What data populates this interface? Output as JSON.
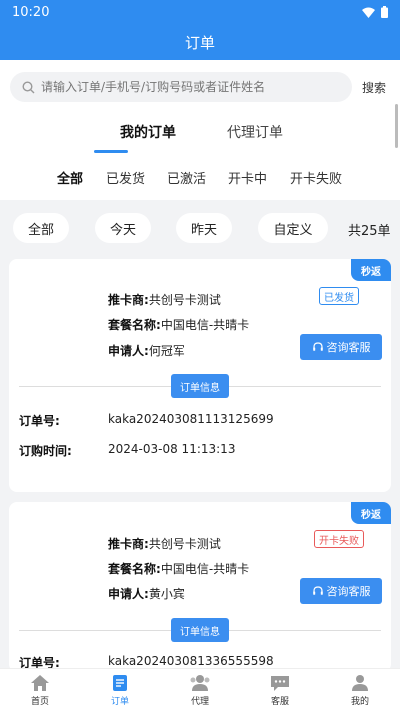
{
  "status_bar": {
    "time": "10:20"
  },
  "app_bar": {
    "title": "订单"
  },
  "search": {
    "placeholder": "请输入订单/手机号/订购号码或者证件姓名",
    "button": "搜索"
  },
  "tabs": [
    {
      "label": "我的订单",
      "active": true
    },
    {
      "label": "代理订单",
      "active": false
    }
  ],
  "status_tabs": [
    "全部",
    "已发货",
    "已激活",
    "开卡中",
    "开卡失败"
  ],
  "filters": [
    "全部",
    "今天",
    "昨天",
    "自定义"
  ],
  "count_label": "共25单",
  "labels": {
    "provider": "推卡商:",
    "package": "套餐名称:",
    "applicant": "申请人:",
    "order_no": "订单号:",
    "order_time": "订购时间:",
    "service": "咨询客服",
    "order_info": "订单信息",
    "badge": "秒返"
  },
  "orders": [
    {
      "provider": "共创号卡测试",
      "package": "中国电信-共晴卡",
      "applicant": "何冠军",
      "status": "已发货",
      "order_no": "kaka202403081113125699",
      "order_time": "2024-03-08 11:13:13"
    },
    {
      "provider": "共创号卡测试",
      "package": "中国电信-共晴卡",
      "applicant": "黄小宾",
      "status": "开卡失败",
      "order_no": "kaka202403081336555598"
    }
  ],
  "bottom_nav": [
    {
      "label": "首页",
      "icon": "home-icon"
    },
    {
      "label": "订单",
      "icon": "order-icon",
      "active": true
    },
    {
      "label": "代理",
      "icon": "agent-icon"
    },
    {
      "label": "客服",
      "icon": "chat-icon"
    },
    {
      "label": "我的",
      "icon": "person-icon"
    }
  ],
  "colors": {
    "primary": "#2f8cf0",
    "danger": "#e85a5a"
  }
}
